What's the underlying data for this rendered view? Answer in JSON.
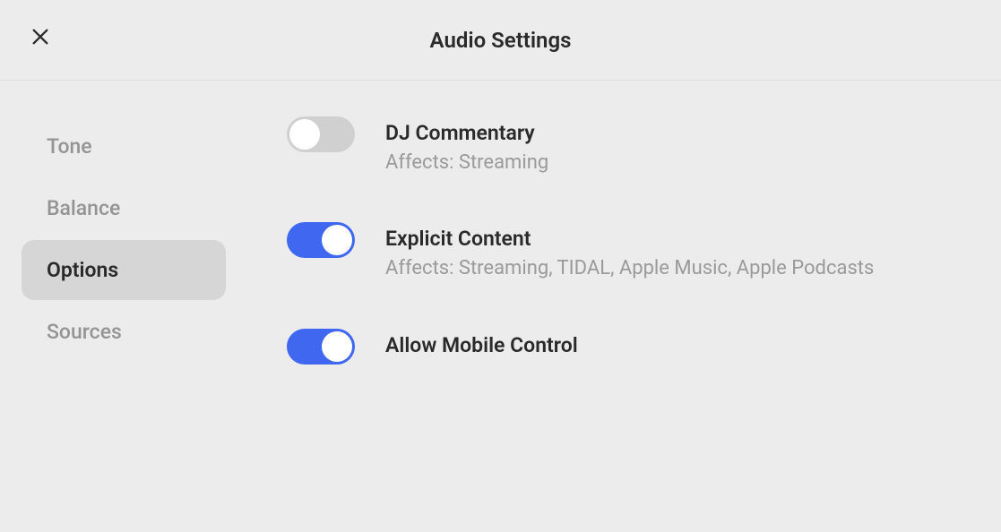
{
  "header": {
    "title": "Audio Settings"
  },
  "sidebar": {
    "items": [
      {
        "label": "Tone",
        "active": false
      },
      {
        "label": "Balance",
        "active": false
      },
      {
        "label": "Options",
        "active": true
      },
      {
        "label": "Sources",
        "active": false
      }
    ]
  },
  "options": [
    {
      "title": "DJ Commentary",
      "subtitle": "Affects: Streaming",
      "enabled": false
    },
    {
      "title": "Explicit Content",
      "subtitle": "Affects: Streaming, TIDAL, Apple Music, Apple Podcasts",
      "enabled": true
    },
    {
      "title": "Allow Mobile Control",
      "subtitle": "",
      "enabled": true
    }
  ]
}
